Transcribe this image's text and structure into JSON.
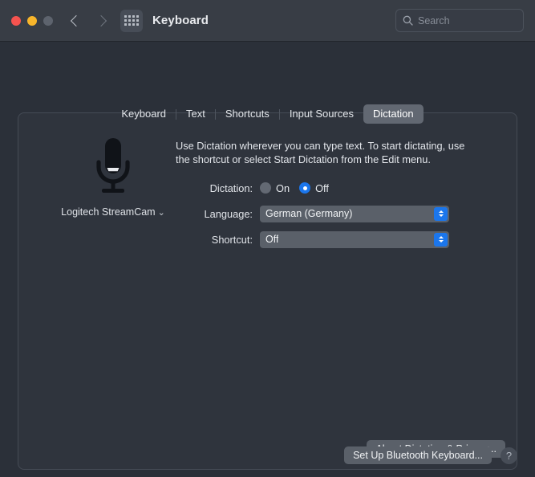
{
  "window": {
    "title": "Keyboard",
    "traffic_lights": [
      "close",
      "minimize",
      "zoom"
    ],
    "back_icon": "chevron-left-icon",
    "forward_icon": "chevron-right-icon",
    "grid_icon": "show-all-grid-icon"
  },
  "search": {
    "placeholder": "Search",
    "value": "",
    "icon": "search-icon"
  },
  "tabs": [
    {
      "label": "Keyboard",
      "active": false
    },
    {
      "label": "Text",
      "active": false
    },
    {
      "label": "Shortcuts",
      "active": false
    },
    {
      "label": "Input Sources",
      "active": false
    },
    {
      "label": "Dictation",
      "active": true
    }
  ],
  "mic": {
    "icon": "microphone-icon",
    "source_label": "Logitech StreamCam",
    "source_chevron": "chevron-down-icon"
  },
  "description": "Use Dictation wherever you can type text. To start dictating, use the shortcut or select Start Dictation from the Edit menu.",
  "fields": {
    "dictation": {
      "label": "Dictation:",
      "options": [
        {
          "label": "On",
          "selected": false
        },
        {
          "label": "Off",
          "selected": true
        }
      ]
    },
    "language": {
      "label": "Language:",
      "value": "German (Germany)",
      "stepper_icon": "stepper-up-down-icon"
    },
    "shortcut": {
      "label": "Shortcut:",
      "value": "Off",
      "stepper_icon": "stepper-up-down-icon"
    }
  },
  "buttons": {
    "about_dictation": "About Dictation & Privacy...",
    "setup_bluetooth_keyboard": "Set Up Bluetooth Keyboard...",
    "help": "?"
  },
  "colors": {
    "accent": "#1b76ec",
    "window_bg": "#2b3039",
    "titlebar_bg": "#383d45",
    "panel_bg": "#2f343d",
    "control_bg": "#5a6069",
    "text": "#e2e5ea",
    "close": "#f5534f",
    "minimize": "#f7b52b",
    "zoom_disabled": "#5d636d"
  }
}
